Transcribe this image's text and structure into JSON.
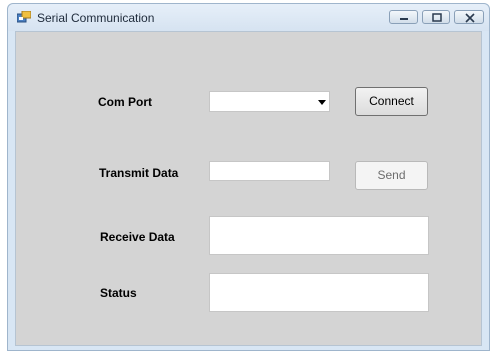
{
  "window": {
    "title": "Serial Communication",
    "icon": "app-form-icon",
    "controls": {
      "minimize": "minimize-icon",
      "maximize": "maximize-icon",
      "close": "close-icon"
    }
  },
  "form": {
    "com_port": {
      "label": "Com Port",
      "selected": ""
    },
    "connect_label": "Connect",
    "transmit": {
      "label": "Transmit Data",
      "value": ""
    },
    "send_label": "Send",
    "receive": {
      "label": "Receive Data",
      "value": ""
    },
    "status": {
      "label": "Status",
      "value": ""
    }
  },
  "colors": {
    "client_background": "#d4d4d4",
    "title_bar": "#d8e6f4"
  }
}
